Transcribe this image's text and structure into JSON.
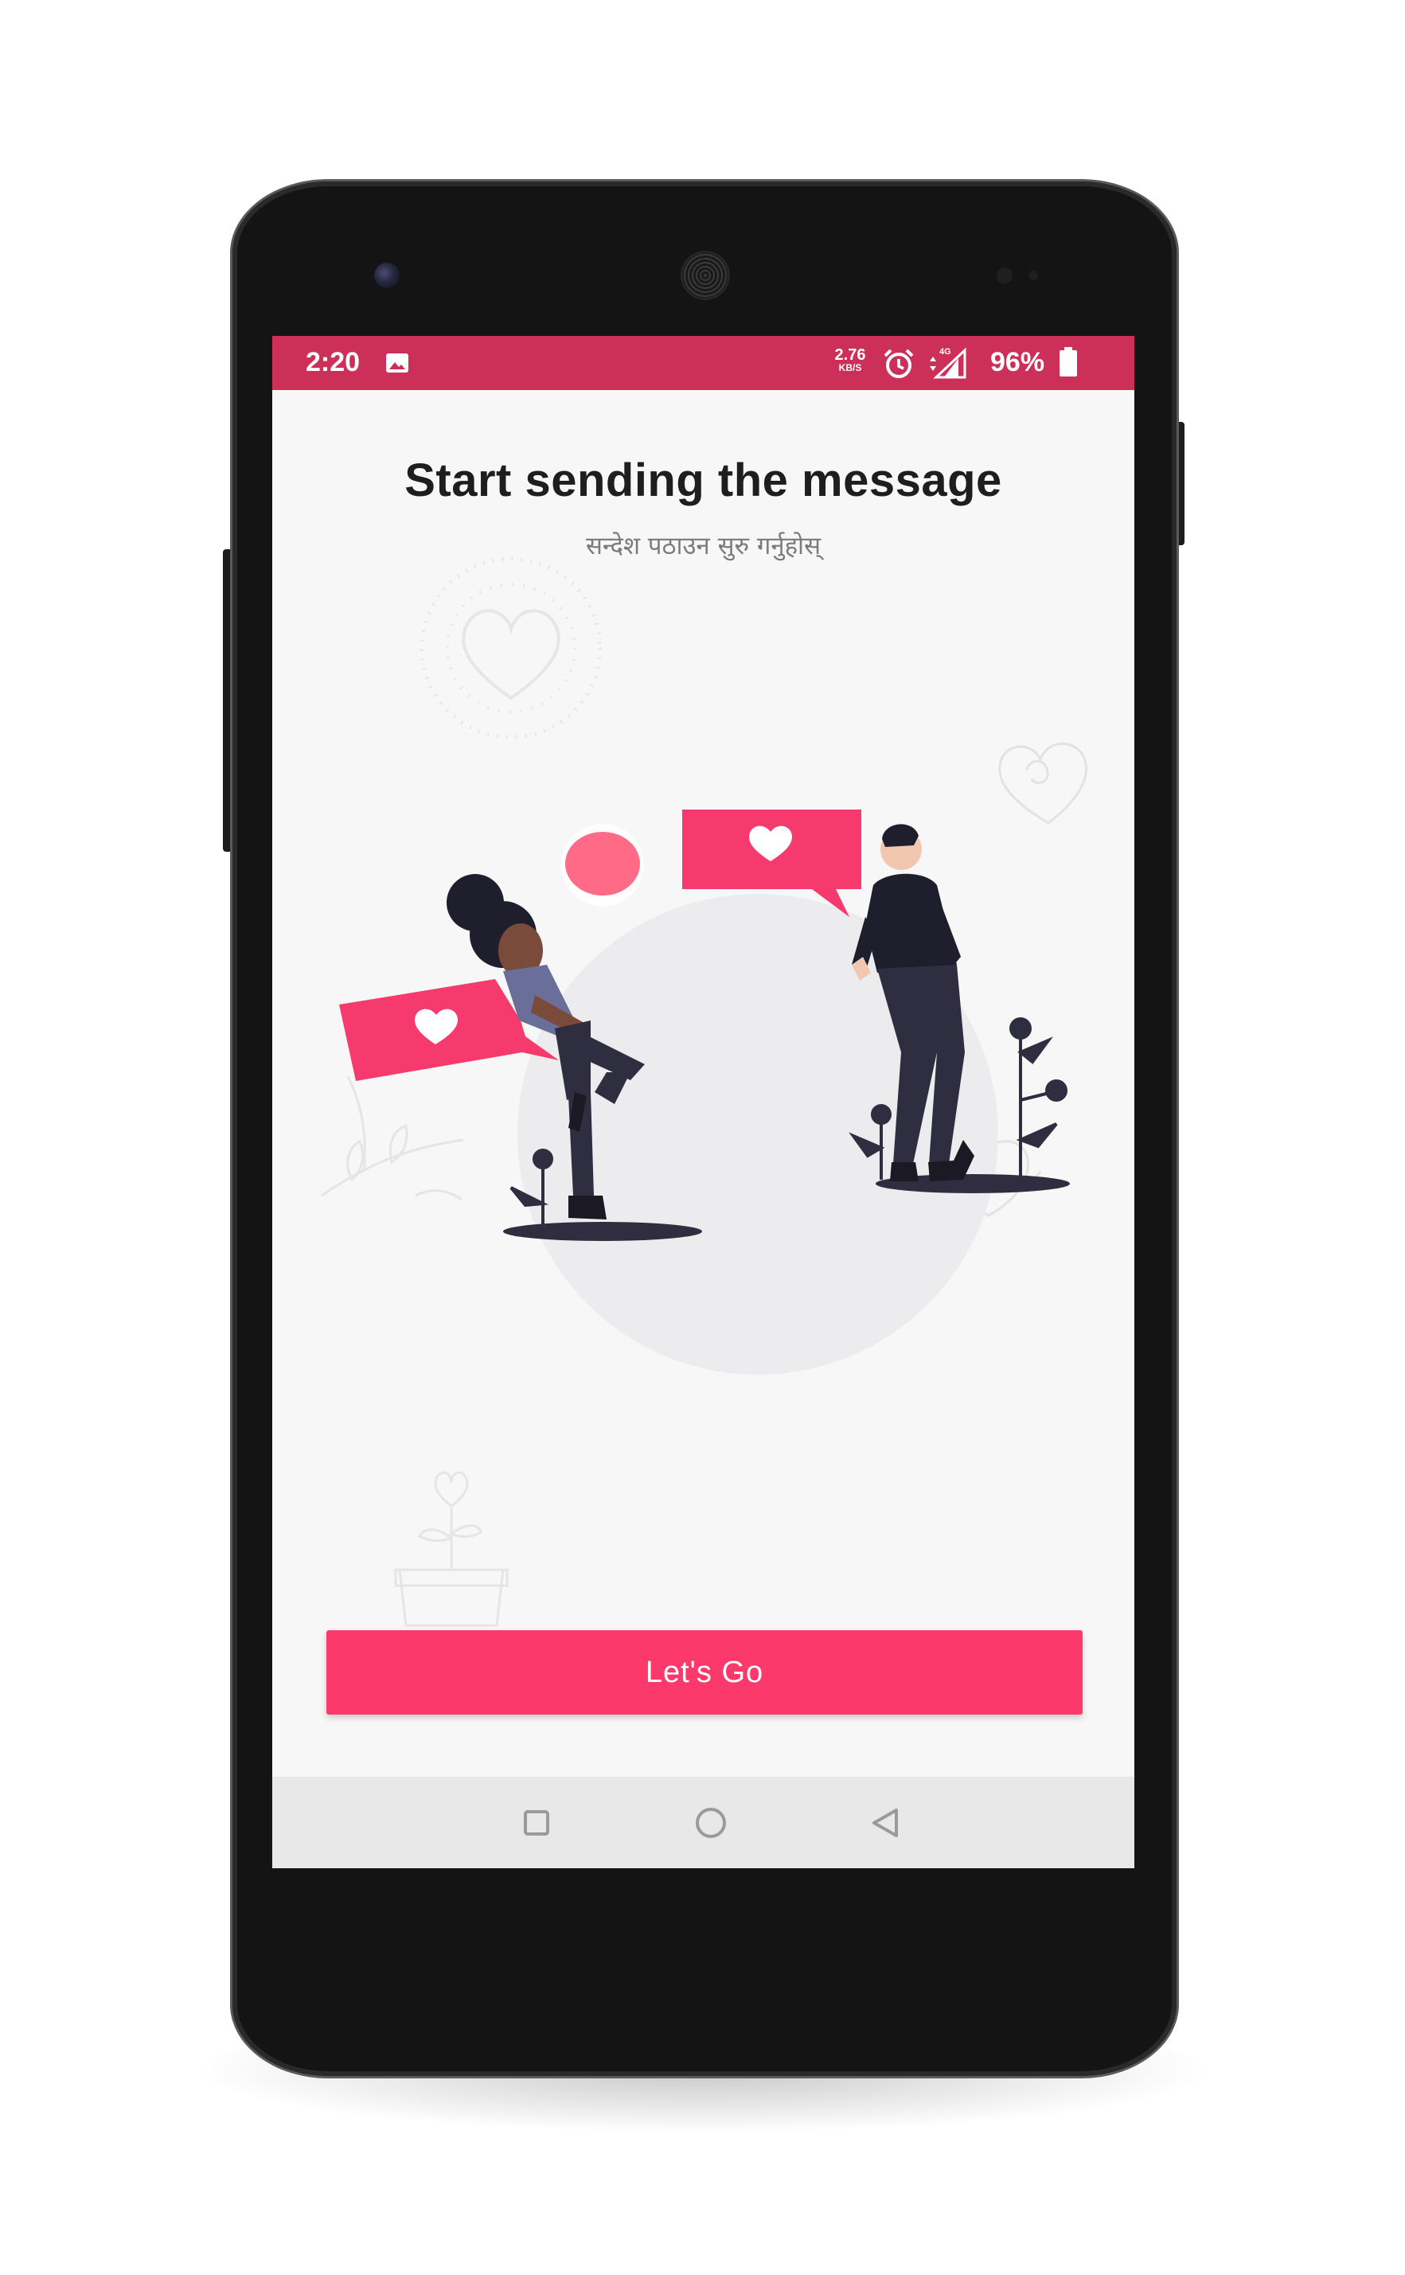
{
  "status_bar": {
    "time": "2:20",
    "net_speed_value": "2.76",
    "net_speed_unit": "KB/S",
    "network_label": "4G",
    "battery_percent": "96%",
    "background_color": "#cc2f58",
    "icons": [
      "image-icon",
      "alarm-icon",
      "signal-icon",
      "battery-icon"
    ]
  },
  "onboarding": {
    "title": "Start sending the message",
    "subtitle": "सन्देश पठाउन सुरु गर्नुहोस्",
    "cta_label": "Let's Go",
    "accent_color": "#fb3a6b"
  },
  "nav_bar": {
    "buttons": [
      "recents-icon",
      "home-icon",
      "back-icon"
    ]
  }
}
